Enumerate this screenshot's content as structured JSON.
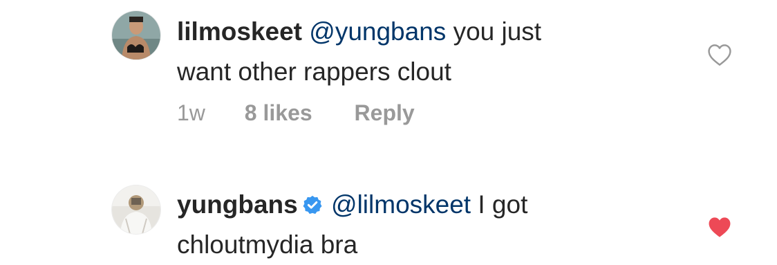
{
  "comments": [
    {
      "username": "lilmoskeet",
      "verified": false,
      "mention": "@yungbans",
      "text_line1": " you just",
      "text_line2": "want other rappers clout",
      "time": "1w",
      "likes": "8 likes",
      "reply": "Reply",
      "liked": false,
      "avatar_icon": "user-avatar-photo"
    },
    {
      "username": "yungbans",
      "verified": true,
      "mention": "@lilmoskeet",
      "text_line1": " I got",
      "text_line2": "chloutmydia bra",
      "liked": true,
      "avatar_icon": "user-avatar-photo"
    }
  ],
  "colors": {
    "text": "#262626",
    "mention": "#003569",
    "meta": "#999999",
    "verified": "#3897f0",
    "heart_liked": "#ed4956",
    "heart_outline": "#999999"
  }
}
